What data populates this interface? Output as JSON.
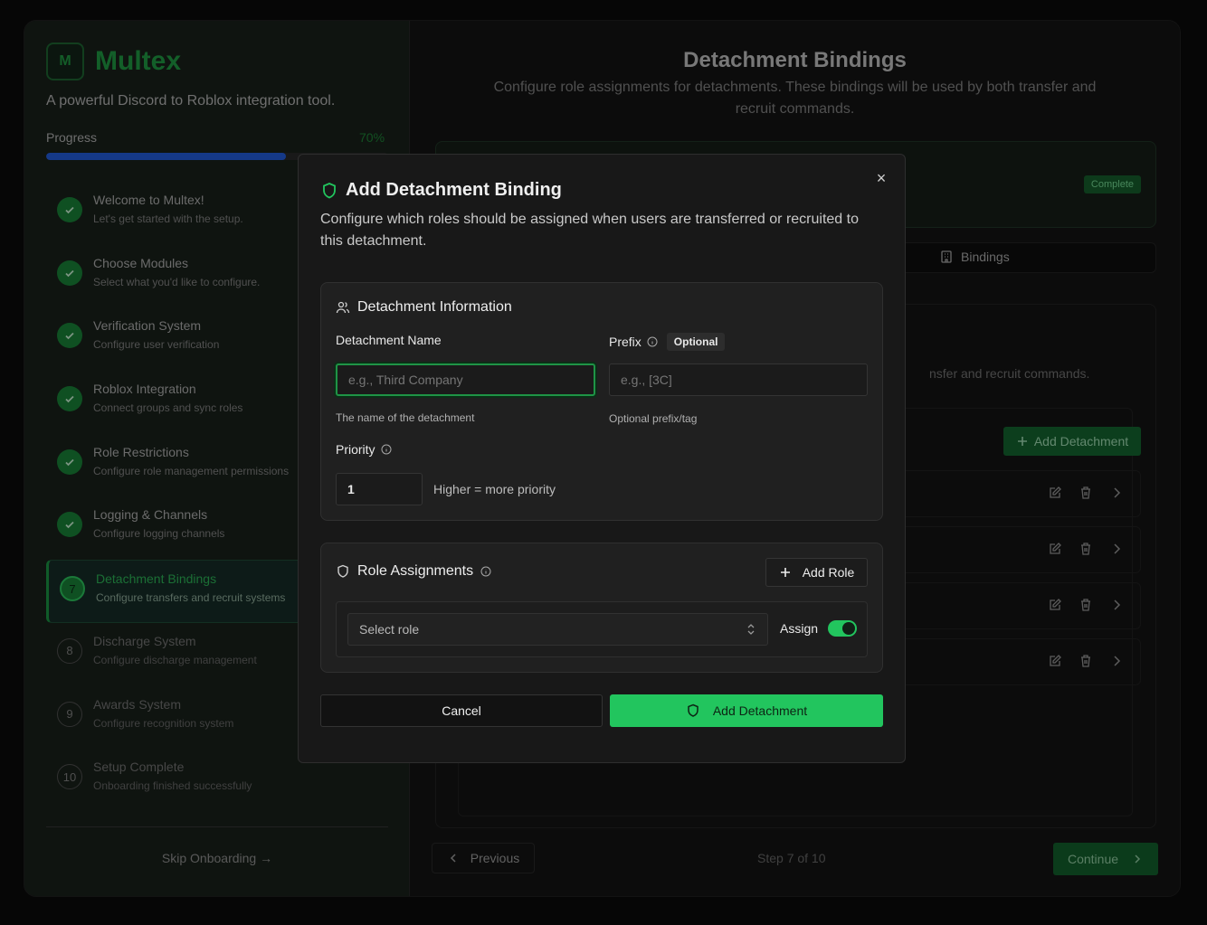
{
  "sidebar": {
    "logo_letter": "M",
    "brand": "Multex",
    "tagline": "A powerful Discord to Roblox integration tool.",
    "progress_label": "Progress",
    "progress_value": "70%",
    "progress_fraction": 0.7,
    "steps": [
      {
        "title": "Welcome to Multex!",
        "subtitle": "Let's get started with the setup.",
        "status": "done"
      },
      {
        "title": "Choose Modules",
        "subtitle": "Select what you'd like to configure.",
        "status": "done"
      },
      {
        "title": "Verification System",
        "subtitle": "Configure user verification",
        "status": "done"
      },
      {
        "title": "Roblox Integration",
        "subtitle": "Connect groups and sync roles",
        "status": "done"
      },
      {
        "title": "Role Restrictions",
        "subtitle": "Configure role management permissions",
        "status": "done"
      },
      {
        "title": "Logging & Channels",
        "subtitle": "Configure logging channels",
        "status": "done"
      },
      {
        "title": "Detachment Bindings",
        "subtitle": "Configure transfers and recruit systems",
        "status": "current",
        "number": "7"
      },
      {
        "title": "Discharge System",
        "subtitle": "Configure discharge management",
        "status": "todo",
        "number": "8"
      },
      {
        "title": "Awards System",
        "subtitle": "Configure recognition system",
        "status": "todo",
        "number": "9"
      },
      {
        "title": "Setup Complete",
        "subtitle": "Onboarding finished successfully",
        "status": "todo",
        "number": "10"
      }
    ],
    "skip_label": "Skip Onboarding →"
  },
  "main": {
    "title": "Detachment Bindings",
    "subtitle": "Configure role assignments for detachments. These bindings will be used by both transfer and recruit commands.",
    "complete_badge": "Complete",
    "tab_bindings": "Bindings",
    "panel_desc_partial": "nsfer and recruit commands.",
    "add_detachment_label": "Add Detachment",
    "footer": {
      "previous_label": "Previous",
      "step_text": "Step 7 of 10",
      "continue_label": "Continue"
    }
  },
  "modal": {
    "title": "Add Detachment Binding",
    "description": "Configure which roles should be assigned when users are transferred or recruited to this detachment.",
    "close_symbol": "×",
    "info_section": {
      "heading": "Detachment Information",
      "name_label": "Detachment Name",
      "name_placeholder": "e.g., Third Company",
      "name_help": "The name of the detachment",
      "prefix_label": "Prefix",
      "optional_badge": "Optional",
      "prefix_placeholder": "e.g., [3C]",
      "prefix_help": "Optional prefix/tag",
      "priority_label": "Priority",
      "priority_value": "1",
      "priority_help": "Higher = more priority"
    },
    "roles_section": {
      "heading": "Role Assignments",
      "add_role_label": "Add Role",
      "select_placeholder": "Select role",
      "assign_label": "Assign",
      "assign_on": true
    },
    "cancel_label": "Cancel",
    "submit_label": "Add Detachment"
  },
  "colors": {
    "accent": "#22c55e",
    "progress": "#2563eb",
    "brand": "#21a447"
  }
}
